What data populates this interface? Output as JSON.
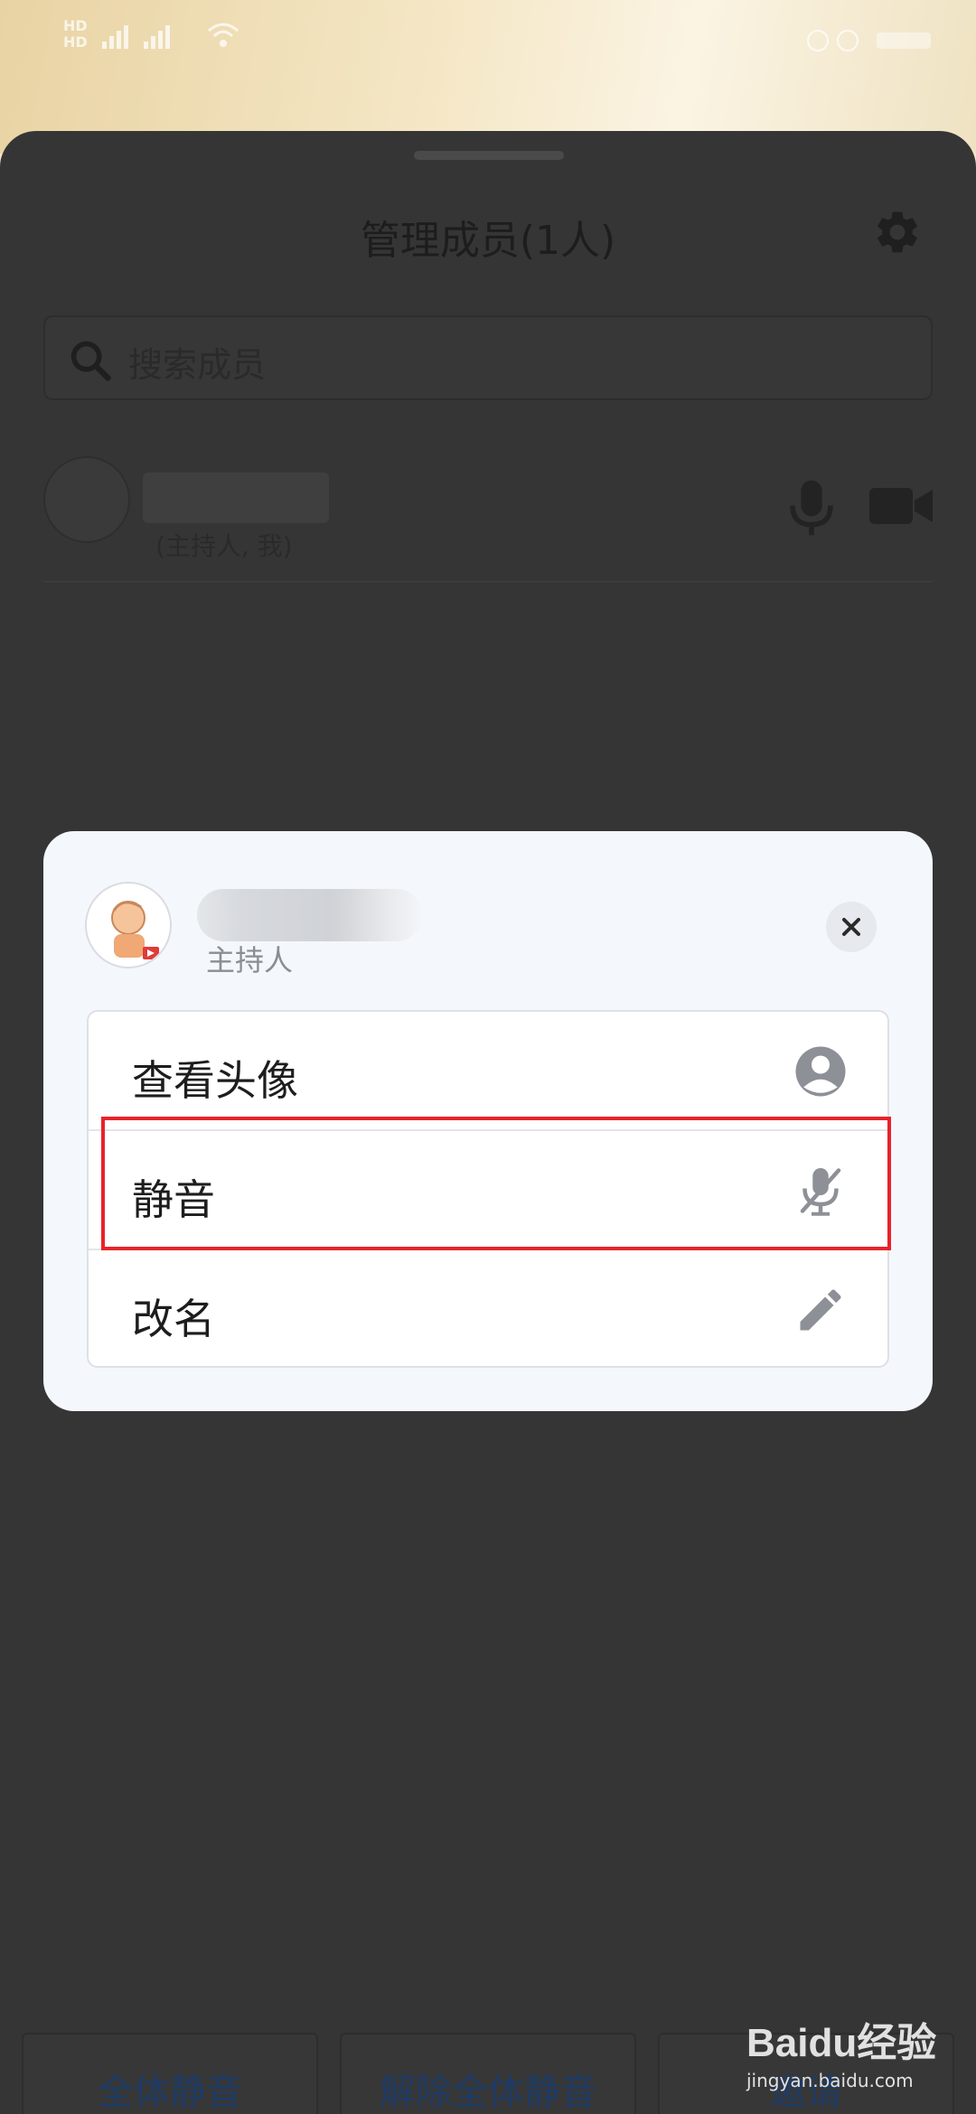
{
  "status_bar": {
    "network_left": "HD",
    "network_left2": "HD"
  },
  "sheet": {
    "title": "管理成员(1人)",
    "search_placeholder": "搜索成员",
    "member": {
      "role": "(主持人, 我)"
    }
  },
  "bottom_buttons": {
    "mute_all": "全体静音",
    "unmute_all": "解除全体静音",
    "invite": "邀请"
  },
  "watermark": {
    "logo": "Baidu经验",
    "site": "jingyan.baidu.com"
  },
  "modal": {
    "role": "主持人",
    "items": [
      {
        "label": "查看头像",
        "icon": "person-circle-icon"
      },
      {
        "label": "静音",
        "icon": "mic-off-icon"
      },
      {
        "label": "改名",
        "icon": "pencil-icon"
      }
    ]
  },
  "colors": {
    "overlay": "#353535",
    "modal_bg": "#f4f7fb",
    "highlight": "#e8232a",
    "button_text": "#1e3b66"
  }
}
